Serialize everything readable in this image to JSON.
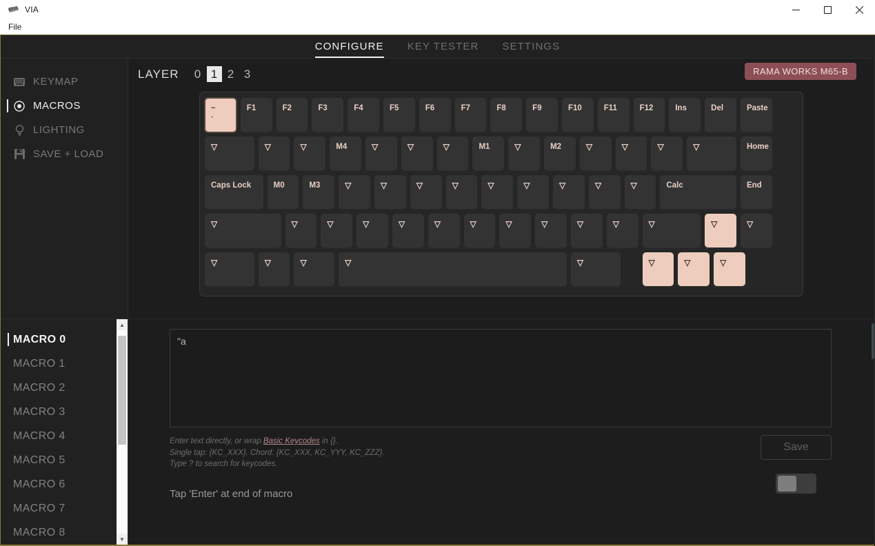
{
  "window": {
    "title": "VIA",
    "app_icon": "keyboard-icon",
    "controls": {
      "minimize": "—",
      "maximize": "☐",
      "close": "✕"
    }
  },
  "menubar": {
    "items": [
      {
        "label": "File"
      }
    ]
  },
  "topnav": {
    "tabs": [
      {
        "label": "CONFIGURE",
        "active": true
      },
      {
        "label": "KEY TESTER",
        "active": false
      },
      {
        "label": "SETTINGS",
        "active": false
      }
    ]
  },
  "sidebar": {
    "items": [
      {
        "label": "KEYMAP",
        "icon": "keyboard-icon",
        "active": false
      },
      {
        "label": "MACROS",
        "icon": "record-circle-icon",
        "active": true
      },
      {
        "label": "LIGHTING",
        "icon": "lightbulb-icon",
        "active": false
      },
      {
        "label": "SAVE + LOAD",
        "icon": "floppy-disk-icon",
        "active": false
      }
    ]
  },
  "layerbar": {
    "label": "LAYER",
    "layers": [
      "0",
      "1",
      "2",
      "3"
    ],
    "selected": "1",
    "keyboard_name": "RAMA WORKS M65-B",
    "badge_color": "#8d4f55"
  },
  "keyboard": {
    "rows": [
      [
        {
          "label": "~\n`",
          "w": 1,
          "highlight": true,
          "selected": true
        },
        {
          "label": "F1",
          "w": 1
        },
        {
          "label": "F2",
          "w": 1
        },
        {
          "label": "F3",
          "w": 1
        },
        {
          "label": "F4",
          "w": 1
        },
        {
          "label": "F5",
          "w": 1
        },
        {
          "label": "F6",
          "w": 1
        },
        {
          "label": "F7",
          "w": 1
        },
        {
          "label": "F8",
          "w": 1
        },
        {
          "label": "F9",
          "w": 1
        },
        {
          "label": "F10",
          "w": 1
        },
        {
          "label": "F11",
          "w": 1
        },
        {
          "label": "F12",
          "w": 1
        },
        {
          "label": "Ins",
          "w": 1
        },
        {
          "label": "Del",
          "w": 1
        },
        {
          "label": "Paste",
          "w": 1
        }
      ],
      [
        {
          "label": "▽",
          "w": 1.5
        },
        {
          "label": "▽",
          "w": 1
        },
        {
          "label": "▽",
          "w": 1
        },
        {
          "label": "M4",
          "w": 1
        },
        {
          "label": "▽",
          "w": 1
        },
        {
          "label": "▽",
          "w": 1
        },
        {
          "label": "▽",
          "w": 1
        },
        {
          "label": "M1",
          "w": 1
        },
        {
          "label": "▽",
          "w": 1
        },
        {
          "label": "M2",
          "w": 1
        },
        {
          "label": "▽",
          "w": 1
        },
        {
          "label": "▽",
          "w": 1
        },
        {
          "label": "▽",
          "w": 1
        },
        {
          "label": "▽",
          "w": 1.5
        },
        {
          "label": "Home",
          "w": 1
        }
      ],
      [
        {
          "label": "Caps Lock",
          "w": 1.75
        },
        {
          "label": "M0",
          "w": 1
        },
        {
          "label": "M3",
          "w": 1
        },
        {
          "label": "▽",
          "w": 1
        },
        {
          "label": "▽",
          "w": 1
        },
        {
          "label": "▽",
          "w": 1
        },
        {
          "label": "▽",
          "w": 1
        },
        {
          "label": "▽",
          "w": 1
        },
        {
          "label": "▽",
          "w": 1
        },
        {
          "label": "▽",
          "w": 1
        },
        {
          "label": "▽",
          "w": 1
        },
        {
          "label": "▽",
          "w": 1
        },
        {
          "label": "Calc",
          "w": 2.25
        },
        {
          "label": "End",
          "w": 1
        }
      ],
      [
        {
          "label": "▽",
          "w": 2.25
        },
        {
          "label": "▽",
          "w": 1
        },
        {
          "label": "▽",
          "w": 1
        },
        {
          "label": "▽",
          "w": 1
        },
        {
          "label": "▽",
          "w": 1
        },
        {
          "label": "▽",
          "w": 1
        },
        {
          "label": "▽",
          "w": 1
        },
        {
          "label": "▽",
          "w": 1
        },
        {
          "label": "▽",
          "w": 1
        },
        {
          "label": "▽",
          "w": 1
        },
        {
          "label": "▽",
          "w": 1
        },
        {
          "label": "▽",
          "w": 1.75
        },
        {
          "label": "▽",
          "w": 1,
          "highlight": true
        },
        {
          "label": "▽",
          "w": 1
        }
      ],
      [
        {
          "label": "▽",
          "w": 1.5
        },
        {
          "label": "▽",
          "w": 1
        },
        {
          "label": "▽",
          "w": 1.25
        },
        {
          "label": "▽",
          "w": 6.5
        },
        {
          "label": "▽",
          "w": 1.5
        },
        {
          "label": "",
          "w": 0.5,
          "spacer": true
        },
        {
          "label": "▽",
          "w": 1,
          "highlight": true
        },
        {
          "label": "▽",
          "w": 1,
          "highlight": true
        },
        {
          "label": "▽",
          "w": 1,
          "highlight": true
        }
      ]
    ]
  },
  "macro_list": {
    "items": [
      {
        "label": "MACRO 0",
        "active": true
      },
      {
        "label": "MACRO 1",
        "active": false
      },
      {
        "label": "MACRO 2",
        "active": false
      },
      {
        "label": "MACRO 3",
        "active": false
      },
      {
        "label": "MACRO 4",
        "active": false
      },
      {
        "label": "MACRO 5",
        "active": false
      },
      {
        "label": "MACRO 6",
        "active": false
      },
      {
        "label": "MACRO 7",
        "active": false
      },
      {
        "label": "MACRO 8",
        "active": false
      }
    ],
    "scroll_up": "▲",
    "scroll_down": "▼"
  },
  "editor": {
    "macro_text": "\"a",
    "placeholder": "",
    "hint_line1_pre": "Enter text directly, or wrap ",
    "hint_link": "Basic Keycodes",
    "hint_line1_post": " in {}.",
    "hint_line2": "Single tap: {KC_XXX}. Chord: {KC_XXX, KC_YYY, KC_ZZZ}.",
    "hint_line3": "Type ? to search for keycodes.",
    "enter_note": "Tap 'Enter' at end of macro",
    "save_label": "Save",
    "save_enabled": false,
    "toggle_on": false
  }
}
